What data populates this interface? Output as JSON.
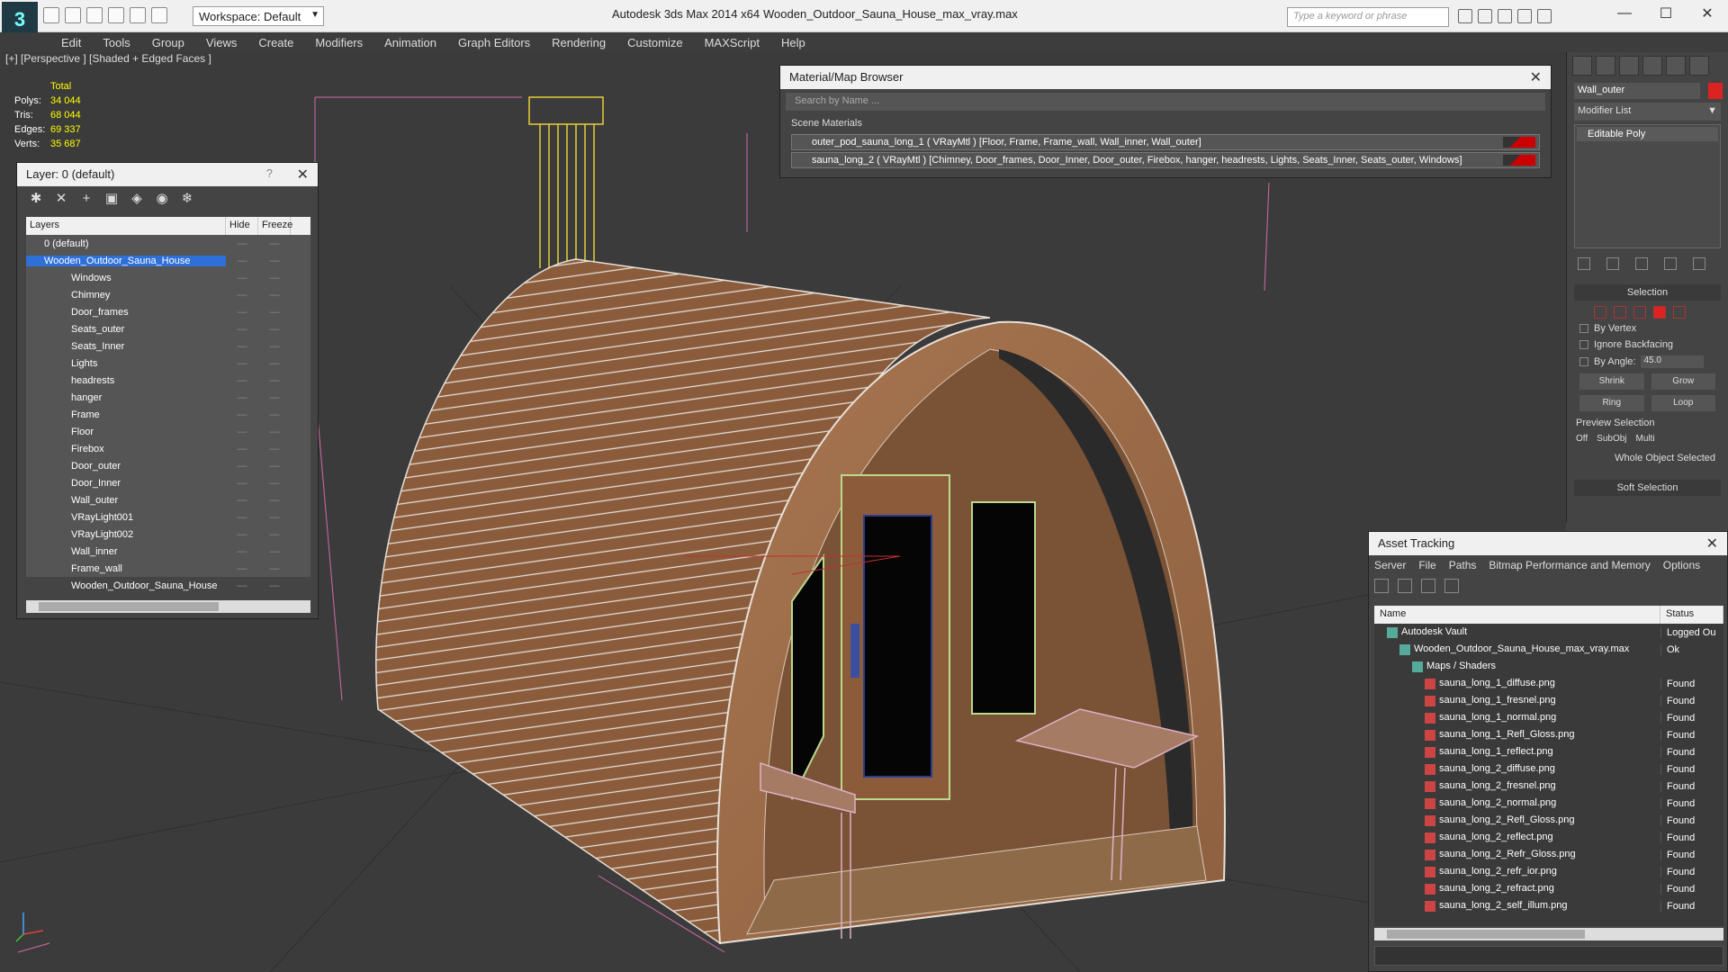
{
  "titlebar": {
    "workspace": "Workspace: Default",
    "app": "Autodesk 3ds Max  2014 x64",
    "file": "Wooden_Outdoor_Sauna_House_max_vray.max",
    "search_placeholder": "Type a keyword or phrase"
  },
  "menu": [
    "Edit",
    "Tools",
    "Group",
    "Views",
    "Create",
    "Modifiers",
    "Animation",
    "Graph Editors",
    "Rendering",
    "Customize",
    "MAXScript",
    "Help"
  ],
  "viewport": {
    "label": "[+] [Perspective ] [Shaded + Edged Faces ]",
    "stats": {
      "total": "Total",
      "polys_label": "Polys:",
      "polys": "34 044",
      "tris_label": "Tris:",
      "tris": "68 044",
      "edges_label": "Edges:",
      "edges": "69 337",
      "verts_label": "Verts:",
      "verts": "35 687"
    }
  },
  "layer_panel": {
    "title": "Layer: 0 (default)",
    "help": "?",
    "col_layers": "Layers",
    "col_hide": "Hide",
    "col_freeze": "Freeze",
    "rows": [
      {
        "name": "0 (default)",
        "child": false,
        "sel": false
      },
      {
        "name": "Wooden_Outdoor_Sauna_House",
        "child": false,
        "sel": true
      },
      {
        "name": "Windows",
        "child": true
      },
      {
        "name": "Chimney",
        "child": true
      },
      {
        "name": "Door_frames",
        "child": true
      },
      {
        "name": "Seats_outer",
        "child": true
      },
      {
        "name": "Seats_Inner",
        "child": true
      },
      {
        "name": "Lights",
        "child": true
      },
      {
        "name": "headrests",
        "child": true
      },
      {
        "name": "hanger",
        "child": true
      },
      {
        "name": "Frame",
        "child": true
      },
      {
        "name": "Floor",
        "child": true
      },
      {
        "name": "Firebox",
        "child": true
      },
      {
        "name": "Door_outer",
        "child": true
      },
      {
        "name": "Door_Inner",
        "child": true
      },
      {
        "name": "Wall_outer",
        "child": true
      },
      {
        "name": "VRayLight001",
        "child": true
      },
      {
        "name": "VRayLight002",
        "child": true
      },
      {
        "name": "Wall_inner",
        "child": true
      },
      {
        "name": "Frame_wall",
        "child": true
      },
      {
        "name": "Wooden_Outdoor_Sauna_House",
        "child": true
      }
    ]
  },
  "material_browser": {
    "title": "Material/Map Browser",
    "search": "Search by Name ...",
    "section": "Scene Materials",
    "materials": [
      "outer_pod_sauna_long_1  ( VRayMtl )  [Floor, Frame, Frame_wall, Wall_inner, Wall_outer]",
      "sauna_long_2  ( VRayMtl )  [Chimney, Door_frames, Door_Inner, Door_outer, Firebox, hanger, headrests, Lights, Seats_Inner, Seats_outer, Windows]"
    ]
  },
  "command_panel": {
    "object_name": "Wall_outer",
    "modifier_list": "Modifier List",
    "stack_item": "Editable Poly",
    "selection": "Selection",
    "by_vertex": "By Vertex",
    "ignore_backfacing": "Ignore Backfacing",
    "by_angle": "By Angle:",
    "angle_value": "45.0",
    "shrink": "Shrink",
    "grow": "Grow",
    "ring": "Ring",
    "loop": "Loop",
    "preview_selection": "Preview Selection",
    "off": "Off",
    "subobj": "SubObj",
    "multi": "Multi",
    "whole_object": "Whole Object Selected",
    "soft_selection": "Soft Selection"
  },
  "asset_tracking": {
    "title": "Asset Tracking",
    "menu": [
      "Server",
      "File",
      "Paths",
      "Bitmap Performance and Memory",
      "Options"
    ],
    "col_name": "Name",
    "col_status": "Status",
    "rows": [
      {
        "name": "Autodesk Vault",
        "status": "Logged Ou",
        "indent": 1
      },
      {
        "name": "Wooden_Outdoor_Sauna_House_max_vray.max",
        "status": "Ok",
        "indent": 2
      },
      {
        "name": "Maps / Shaders",
        "status": "",
        "indent": 3
      },
      {
        "name": "sauna_long_1_diffuse.png",
        "status": "Found",
        "indent": 4
      },
      {
        "name": "sauna_long_1_fresnel.png",
        "status": "Found",
        "indent": 4
      },
      {
        "name": "sauna_long_1_normal.png",
        "status": "Found",
        "indent": 4
      },
      {
        "name": "sauna_long_1_Refl_Gloss.png",
        "status": "Found",
        "indent": 4
      },
      {
        "name": "sauna_long_1_reflect.png",
        "status": "Found",
        "indent": 4
      },
      {
        "name": "sauna_long_2_diffuse.png",
        "status": "Found",
        "indent": 4
      },
      {
        "name": "sauna_long_2_fresnel.png",
        "status": "Found",
        "indent": 4
      },
      {
        "name": "sauna_long_2_normal.png",
        "status": "Found",
        "indent": 4
      },
      {
        "name": "sauna_long_2_Refl_Gloss.png",
        "status": "Found",
        "indent": 4
      },
      {
        "name": "sauna_long_2_reflect.png",
        "status": "Found",
        "indent": 4
      },
      {
        "name": "sauna_long_2_Refr_Gloss.png",
        "status": "Found",
        "indent": 4
      },
      {
        "name": "sauna_long_2_refr_ior.png",
        "status": "Found",
        "indent": 4
      },
      {
        "name": "sauna_long_2_refract.png",
        "status": "Found",
        "indent": 4
      },
      {
        "name": "sauna_long_2_self_illum.png",
        "status": "Found",
        "indent": 4
      }
    ]
  },
  "colors": {
    "selection": "#2e6fd8",
    "stats": "#ffff00",
    "wood": "#8a5c3c",
    "object_color": "#dd2222"
  }
}
